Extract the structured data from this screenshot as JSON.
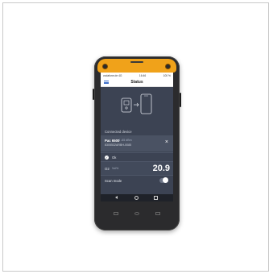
{
  "status_bar": {
    "carrier": "vodafone.de 4G",
    "time": "16:46",
    "battery": "100 %"
  },
  "app_bar": {
    "title": "Status",
    "menu_icon": "hamburger-menu-icon"
  },
  "connection": {
    "section_label": "Connected device",
    "device_name": "Pac 6500",
    "signal": "4 -65 dBm",
    "serial": "8305532ARBH-0085",
    "close_icon": "close-icon"
  },
  "status_row": {
    "label": "Ok",
    "icon": "check-circle-icon"
  },
  "measurement": {
    "gas": "O2",
    "unit": "Vol%",
    "value": "20.9"
  },
  "scan_mode": {
    "label": "Scan mode",
    "enabled": true
  },
  "colors": {
    "bumper": "#f0a21a",
    "screen_bg": "#3c4353",
    "accent": "#3d6ec9"
  }
}
